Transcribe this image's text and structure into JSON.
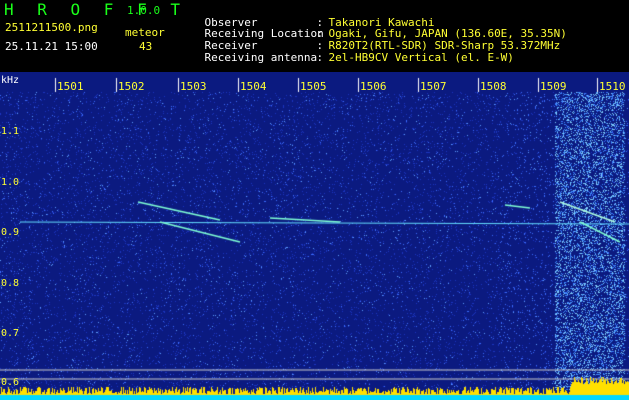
{
  "header": {
    "app_name": "H R O F F T",
    "version": "1.0.0",
    "filename": "2511211500.png",
    "datetime": "25.11.21 15:00",
    "count_label": "meteor",
    "count_value": "43",
    "info": [
      {
        "key": "Observer",
        "value": "Takanori Kawachi"
      },
      {
        "key": "Receiving Location",
        "value": "Ogaki, Gifu, JAPAN (136.60E, 35.35N)"
      },
      {
        "key": "Receiver",
        "value": "R820T2(RTL-SDR) SDR-Sharp 53.372MHz"
      },
      {
        "key": "Receiving antenna",
        "value": "2el-HB9CV Vertical (el. E-W)"
      }
    ],
    "separator": ":"
  },
  "spectrogram": {
    "y_unit": "kHz",
    "y_ticks": [
      "1.1",
      "1.0",
      "0.9",
      "0.8",
      "0.7",
      "0.6"
    ],
    "x_ticks": [
      "1501",
      "1502",
      "1503",
      "1504",
      "1505",
      "1506",
      "1507",
      "1508",
      "1509",
      "1510"
    ],
    "colors": {
      "background": "#0a1f8c",
      "noise": "#2a4fe0",
      "echo": "#7fffd4",
      "level_bar": "#ffe000",
      "level_bar2": "#00e5ff",
      "axis_text": "#ffff33"
    }
  }
}
